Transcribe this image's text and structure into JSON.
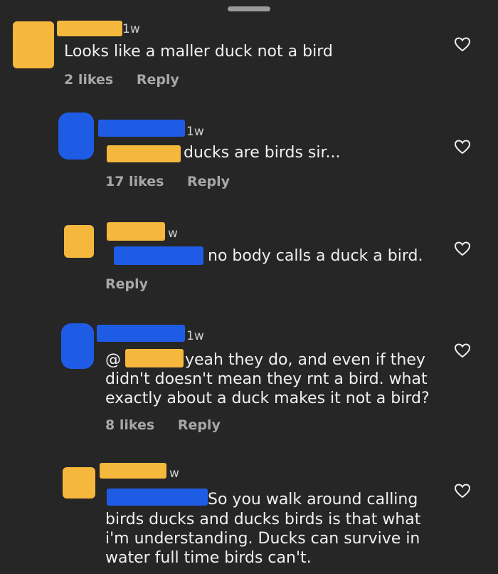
{
  "colors": {
    "background": "#262626",
    "redact_orange": "#f5b73c",
    "redact_blue": "#1f5ce6",
    "muted": "#a8a8a8"
  },
  "comments": [
    {
      "time": "1w",
      "text": "Looks like a maller duck not a bird",
      "likes": "2 likes",
      "reply": "Reply"
    },
    {
      "time": "1w",
      "text": "ducks are birds sir...",
      "likes": "17 likes",
      "reply": "Reply"
    },
    {
      "time": "w",
      "text": "no body calls a duck a bird.",
      "reply": "Reply"
    },
    {
      "time": "1w",
      "mention": "@",
      "text_line1": "yeah they do, and even if they",
      "text_line2": "didn't doesn't mean they rnt a bird. what",
      "text_line3": "exactly about a duck makes it not a bird?",
      "likes": "8 likes",
      "reply": "Reply"
    },
    {
      "time": "w",
      "text_line1": "So you walk around calling",
      "text_line2": "birds ducks and ducks birds is that what",
      "text_line3": "i'm understanding. Ducks can survive in",
      "text_line4": "water full time birds can't."
    }
  ],
  "icons": {
    "like": "heart-outline-icon"
  }
}
